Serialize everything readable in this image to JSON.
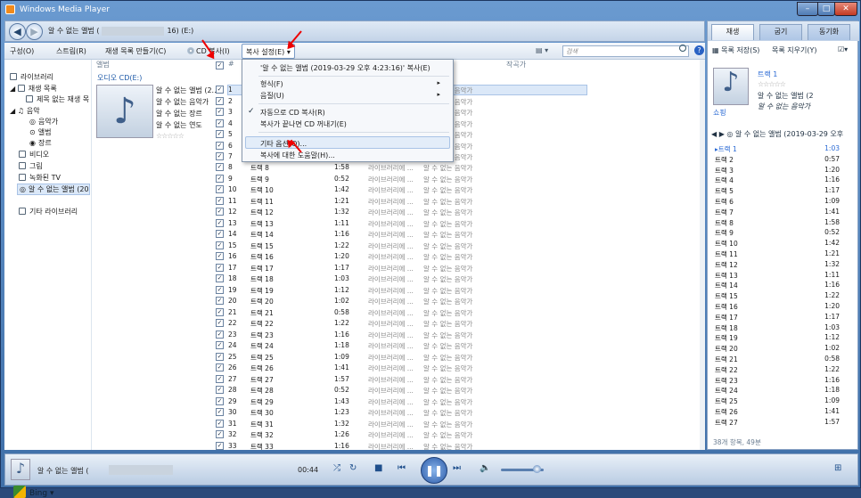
{
  "window": {
    "title": "Windows Media Player"
  },
  "nav": {
    "breadcrumb_start": "알 수 없는 앨범 (",
    "breadcrumb_end": "16) (E:)"
  },
  "toolbar": {
    "organize": "구성(O)",
    "stream": "스트림(R)",
    "create_playlist": "재생 목록 만들기(C)",
    "rip_cd": "CD 복사(I)",
    "rip_settings": "복사 설정(E)",
    "search_placeholder": "검색"
  },
  "sidebar": {
    "library": "라이브러리",
    "playlists": "재생 목록",
    "untitled_playlist": "제목 없는 재생 목",
    "music": "음악",
    "artist": "음악가",
    "album": "앨범",
    "genre": "장르",
    "video": "비디오",
    "pictures": "그림",
    "recorded_tv": "녹화된 TV",
    "unknown_album": "알 수 없는 앨범 (20",
    "other_libraries": "기타 라이브러리",
    "bing": "Bing"
  },
  "columns": {
    "album": "앨범",
    "track_num": "#",
    "composer": "작곡가"
  },
  "album": {
    "header": "오디오 CD(E:)",
    "title": "알 수 없는 앨범 (2...",
    "artist": "알 수 없는 음악가",
    "genre": "알 수 없는 장르",
    "year": "알 수 없는 연도",
    "rating": "☆☆☆☆☆"
  },
  "tracks": [
    {
      "n": "8",
      "title": "트랙 8",
      "len": "1:58"
    },
    {
      "n": "9",
      "title": "트랙 9",
      "len": "0:52"
    },
    {
      "n": "10",
      "title": "트랙 10",
      "len": "1:42"
    },
    {
      "n": "11",
      "title": "트랙 11",
      "len": "1:21"
    },
    {
      "n": "12",
      "title": "트랙 12",
      "len": "1:32"
    },
    {
      "n": "13",
      "title": "트랙 13",
      "len": "1:11"
    },
    {
      "n": "14",
      "title": "트랙 14",
      "len": "1:16"
    },
    {
      "n": "15",
      "title": "트랙 15",
      "len": "1:22"
    },
    {
      "n": "16",
      "title": "트랙 16",
      "len": "1:20"
    },
    {
      "n": "17",
      "title": "트랙 17",
      "len": "1:17"
    },
    {
      "n": "18",
      "title": "트랙 18",
      "len": "1:03"
    },
    {
      "n": "19",
      "title": "트랙 19",
      "len": "1:12"
    },
    {
      "n": "20",
      "title": "트랙 20",
      "len": "1:02"
    },
    {
      "n": "21",
      "title": "트랙 21",
      "len": "0:58"
    },
    {
      "n": "22",
      "title": "트랙 22",
      "len": "1:22"
    },
    {
      "n": "23",
      "title": "트랙 23",
      "len": "1:16"
    },
    {
      "n": "24",
      "title": "트랙 24",
      "len": "1:18"
    },
    {
      "n": "25",
      "title": "트랙 25",
      "len": "1:09"
    },
    {
      "n": "26",
      "title": "트랙 26",
      "len": "1:41"
    },
    {
      "n": "27",
      "title": "트랙 27",
      "len": "1:57"
    },
    {
      "n": "28",
      "title": "트랙 28",
      "len": "0:52"
    },
    {
      "n": "29",
      "title": "트랙 29",
      "len": "1:43"
    },
    {
      "n": "30",
      "title": "트랙 30",
      "len": "1:23"
    },
    {
      "n": "31",
      "title": "트랙 31",
      "len": "1:32"
    },
    {
      "n": "32",
      "title": "트랙 32",
      "len": "1:26"
    },
    {
      "n": "33",
      "title": "트랙 33",
      "len": "1:16"
    }
  ],
  "track_status": "라이브러리에 ...",
  "track_artist": "알 수 없는 음악가",
  "menu": {
    "header": "'알 수 없는 앨범 (2019-03-29 오후 4:23:16)' 복사(E)",
    "format": "형식(F)",
    "quality": "음질(U)",
    "auto_rip": "자동으로 CD 복사(R)",
    "eject": "복사가 끝나면 CD 꺼내기(E)",
    "more_options": "기타 옵션(O)...",
    "help": "복사에 대한 도움말(H)..."
  },
  "right_panel": {
    "tab_play": "재생",
    "tab_burn": "굽기",
    "tab_sync": "동기화",
    "save_list": "목록 저장(S)",
    "clear_list": "목록 지우기(Y)",
    "track_title": "트랙 1",
    "rating": "☆☆☆☆☆",
    "album": "알 수 없는 앨범 (2",
    "artist": "알 수 없는 음악가",
    "shopping": "쇼핑",
    "playlist_title": "알 수 없는 앨범 (2019-03-29 오후",
    "footer": "38개 항목, 49분"
  },
  "now_playing": [
    {
      "t": "트랙 1",
      "d": "1:03"
    },
    {
      "t": "트랙 2",
      "d": "0:57"
    },
    {
      "t": "트랙 3",
      "d": "1:20"
    },
    {
      "t": "트랙 4",
      "d": "1:16"
    },
    {
      "t": "트랙 5",
      "d": "1:17"
    },
    {
      "t": "트랙 6",
      "d": "1:09"
    },
    {
      "t": "트랙 7",
      "d": "1:41"
    },
    {
      "t": "트랙 8",
      "d": "1:58"
    },
    {
      "t": "트랙 9",
      "d": "0:52"
    },
    {
      "t": "트랙 10",
      "d": "1:42"
    },
    {
      "t": "트랙 11",
      "d": "1:21"
    },
    {
      "t": "트랙 12",
      "d": "1:32"
    },
    {
      "t": "트랙 13",
      "d": "1:11"
    },
    {
      "t": "트랙 14",
      "d": "1:16"
    },
    {
      "t": "트랙 15",
      "d": "1:22"
    },
    {
      "t": "트랙 16",
      "d": "1:20"
    },
    {
      "t": "트랙 17",
      "d": "1:17"
    },
    {
      "t": "트랙 18",
      "d": "1:03"
    },
    {
      "t": "트랙 19",
      "d": "1:12"
    },
    {
      "t": "트랙 20",
      "d": "1:02"
    },
    {
      "t": "트랙 21",
      "d": "0:58"
    },
    {
      "t": "트랙 22",
      "d": "1:22"
    },
    {
      "t": "트랙 23",
      "d": "1:16"
    },
    {
      "t": "트랙 24",
      "d": "1:18"
    },
    {
      "t": "트랙 25",
      "d": "1:09"
    },
    {
      "t": "트랙 26",
      "d": "1:41"
    },
    {
      "t": "트랙 27",
      "d": "1:57"
    }
  ],
  "player": {
    "album": "알 수 없는 앨범 (",
    "time": "00:44"
  }
}
